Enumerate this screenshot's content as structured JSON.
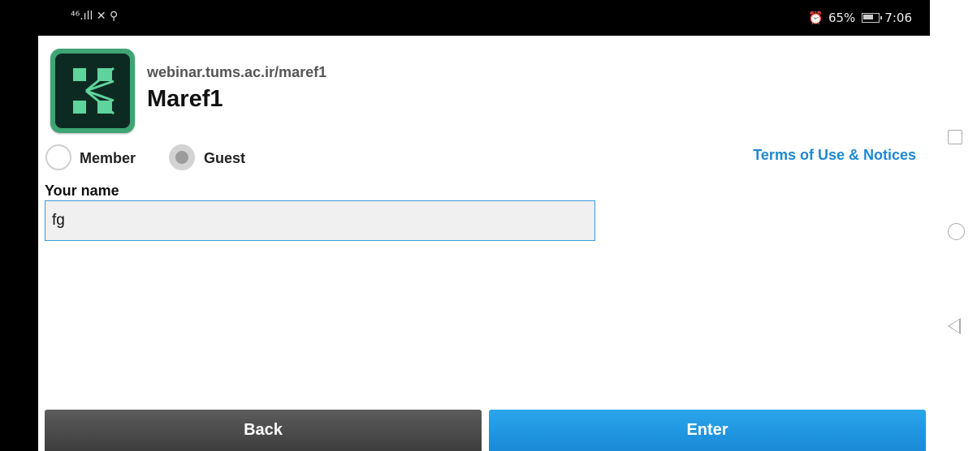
{
  "status_bar": {
    "left_indicators": "⁴⁶.ıll ✕ ⚲",
    "alarm_icon": "alarm-icon",
    "battery_percent": "65%",
    "battery_level": 0.65,
    "time": "7:06"
  },
  "room": {
    "url": "webinar.tums.ac.ir/maref1",
    "name": "Maref1"
  },
  "login_type": {
    "member_label": "Member",
    "guest_label": "Guest",
    "selected": "Guest"
  },
  "terms_link": "Terms of Use & Notices",
  "name_field": {
    "label": "Your name",
    "value": "fg"
  },
  "buttons": {
    "back": "Back",
    "enter": "Enter"
  },
  "colors": {
    "accent_blue": "#1e88d2",
    "enter_button": "#1a8ad6",
    "back_button": "#4a4a4a",
    "app_icon_green": "#3ea574"
  }
}
